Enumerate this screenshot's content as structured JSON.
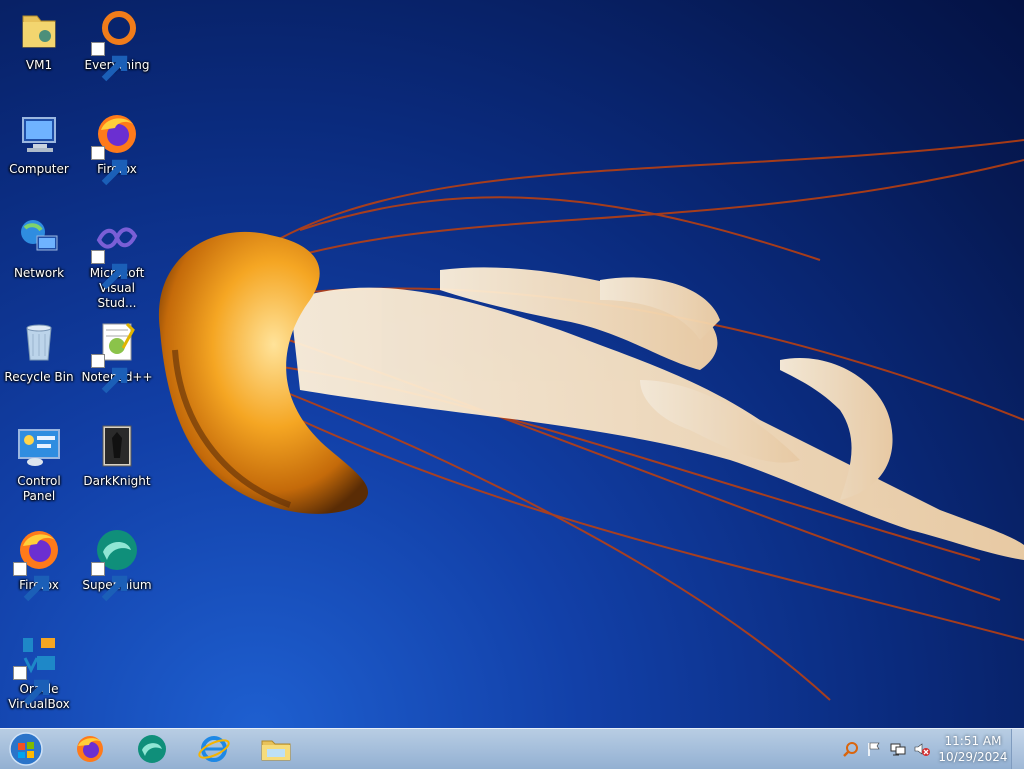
{
  "desktop": {
    "icons": [
      {
        "label": "VM1",
        "icon": "folder-icon"
      },
      {
        "label": "Everything",
        "icon": "everything-icon"
      },
      {
        "label": "Computer",
        "icon": "computer-icon"
      },
      {
        "label": "Firefox",
        "icon": "firefox-icon"
      },
      {
        "label": "Network",
        "icon": "network-icon"
      },
      {
        "label": "Microsoft Visual Stud...",
        "icon": "visual-studio-icon"
      },
      {
        "label": "Recycle Bin",
        "icon": "recycle-bin-icon"
      },
      {
        "label": "Notepad++",
        "icon": "notepad-plus-plus-icon"
      },
      {
        "label": "Control Panel",
        "icon": "control-panel-icon"
      },
      {
        "label": "DarkKnight",
        "icon": "darkknight-icon"
      },
      {
        "label": "Firefox",
        "icon": "firefox-icon"
      },
      {
        "label": "Supermium",
        "icon": "supermium-icon"
      },
      {
        "label": "Oracle VirtualBox",
        "icon": "virtualbox-icon"
      }
    ]
  },
  "taskbar": {
    "pinned": [
      "firefox-icon",
      "supermium-icon",
      "internet-explorer-icon",
      "file-explorer-icon"
    ],
    "tray": [
      "search-icon",
      "action-center-flag-icon",
      "network-icon",
      "volume-muted-icon"
    ],
    "clock": {
      "time": "11:51 AM",
      "date": "10/29/2024"
    }
  }
}
